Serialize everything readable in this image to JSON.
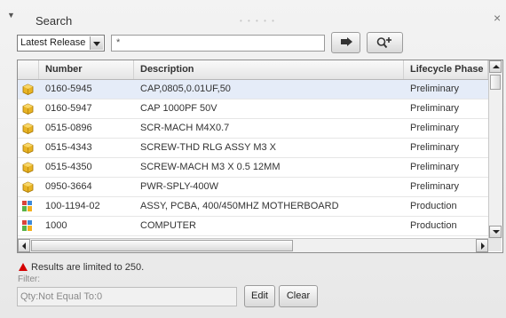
{
  "header": {
    "title": "Search",
    "grip": "• • • • •",
    "close": "×"
  },
  "search_bar": {
    "scope": "Latest Release",
    "query": "*"
  },
  "grid": {
    "columns": [
      "Number",
      "Description",
      "Lifecycle Phase"
    ],
    "rows": [
      {
        "number": "0160-5945",
        "description": "CAP,0805,0.01UF,50",
        "lifecycle": "Preliminary",
        "icon": "part-cube-icon",
        "selected": true
      },
      {
        "number": "0160-5947",
        "description": "CAP 1000PF 50V",
        "lifecycle": "Preliminary",
        "icon": "part-cube-icon"
      },
      {
        "number": "0515-0896",
        "description": "SCR-MACH M4X0.7",
        "lifecycle": "Preliminary",
        "icon": "part-cube-icon"
      },
      {
        "number": "0515-4343",
        "description": "SCREW-THD RLG ASSY M3 X",
        "lifecycle": "Preliminary",
        "icon": "part-cube-icon"
      },
      {
        "number": "0515-4350",
        "description": "SCREW-MACH M3 X 0.5 12MM",
        "lifecycle": "Preliminary",
        "icon": "part-cube-icon"
      },
      {
        "number": "0950-3664",
        "description": "PWR-SPLY-400W",
        "lifecycle": "Preliminary",
        "icon": "part-cube-icon"
      },
      {
        "number": "100-1194-02",
        "description": "ASSY, PCBA, 400/450MHZ MOTHERBOARD",
        "lifecycle": "Production",
        "icon": "assembly-icon"
      },
      {
        "number": "1000",
        "description": "COMPUTER",
        "lifecycle": "Production",
        "icon": "assembly-icon"
      }
    ]
  },
  "footer": {
    "warning": "Results are limited to 250.",
    "filter_label": "Filter:",
    "filter_value": "Qty:Not Equal To:0",
    "edit_label": "Edit",
    "clear_label": "Clear"
  },
  "colors": {
    "selected_row": "#e5ecf8",
    "warning_red": "#d40000",
    "part_icon": "#e8b425"
  }
}
